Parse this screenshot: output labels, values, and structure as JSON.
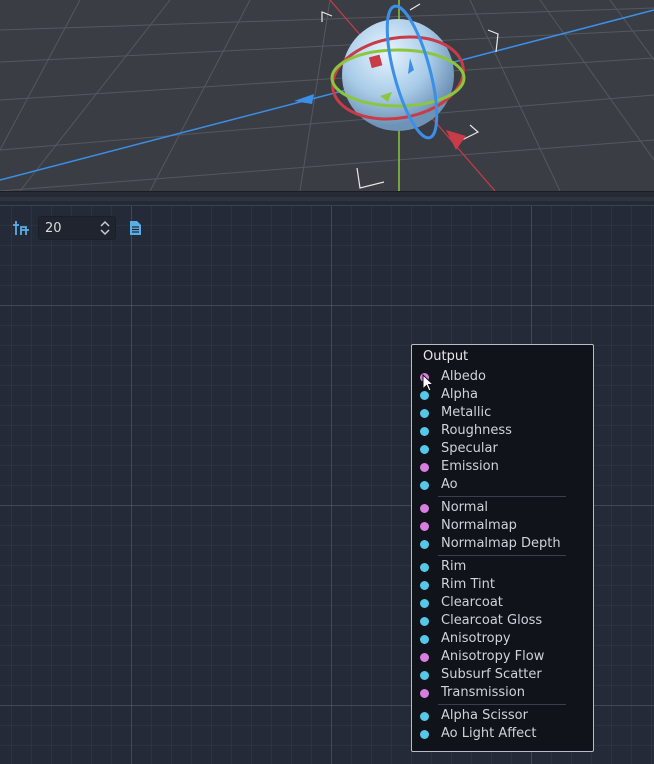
{
  "viewport": {
    "label": "3D viewport",
    "gizmo": "transform-gizmo"
  },
  "toolbar": {
    "snap_icon": "snap-grid-icon",
    "snap_value": "20",
    "spin_icon": "spinner-arrows-icon",
    "doc_icon": "document-icon"
  },
  "output_node": {
    "title": "Output",
    "ports": [
      {
        "label": "Albedo",
        "color": "#d77ee0"
      },
      {
        "label": "Alpha",
        "color": "#55c8e8"
      },
      {
        "label": "Metallic",
        "color": "#55c8e8"
      },
      {
        "label": "Roughness",
        "color": "#55c8e8"
      },
      {
        "label": "Specular",
        "color": "#55c8e8"
      },
      {
        "label": "Emission",
        "color": "#d77ee0"
      },
      {
        "label": "Ao",
        "color": "#55c8e8"
      },
      {
        "label": "Normal",
        "color": "#d77ee0"
      },
      {
        "label": "Normalmap",
        "color": "#d77ee0"
      },
      {
        "label": "Normalmap Depth",
        "color": "#55c8e8"
      },
      {
        "label": "Rim",
        "color": "#55c8e8"
      },
      {
        "label": "Rim Tint",
        "color": "#55c8e8"
      },
      {
        "label": "Clearcoat",
        "color": "#55c8e8"
      },
      {
        "label": "Clearcoat Gloss",
        "color": "#55c8e8"
      },
      {
        "label": "Anisotropy",
        "color": "#55c8e8"
      },
      {
        "label": "Anisotropy Flow",
        "color": "#d77ee0"
      },
      {
        "label": "Subsurf Scatter",
        "color": "#55c8e8"
      },
      {
        "label": "Transmission",
        "color": "#d77ee0"
      },
      {
        "label": "Alpha Scissor",
        "color": "#55c8e8"
      },
      {
        "label": "Ao Light Affect",
        "color": "#55c8e8"
      }
    ]
  },
  "colors": {
    "vector_port": "#d77ee0",
    "scalar_port": "#55c8e8",
    "axis_x": "#d0404a",
    "axis_y": "#8cc63e",
    "axis_z": "#3a8fe8"
  }
}
